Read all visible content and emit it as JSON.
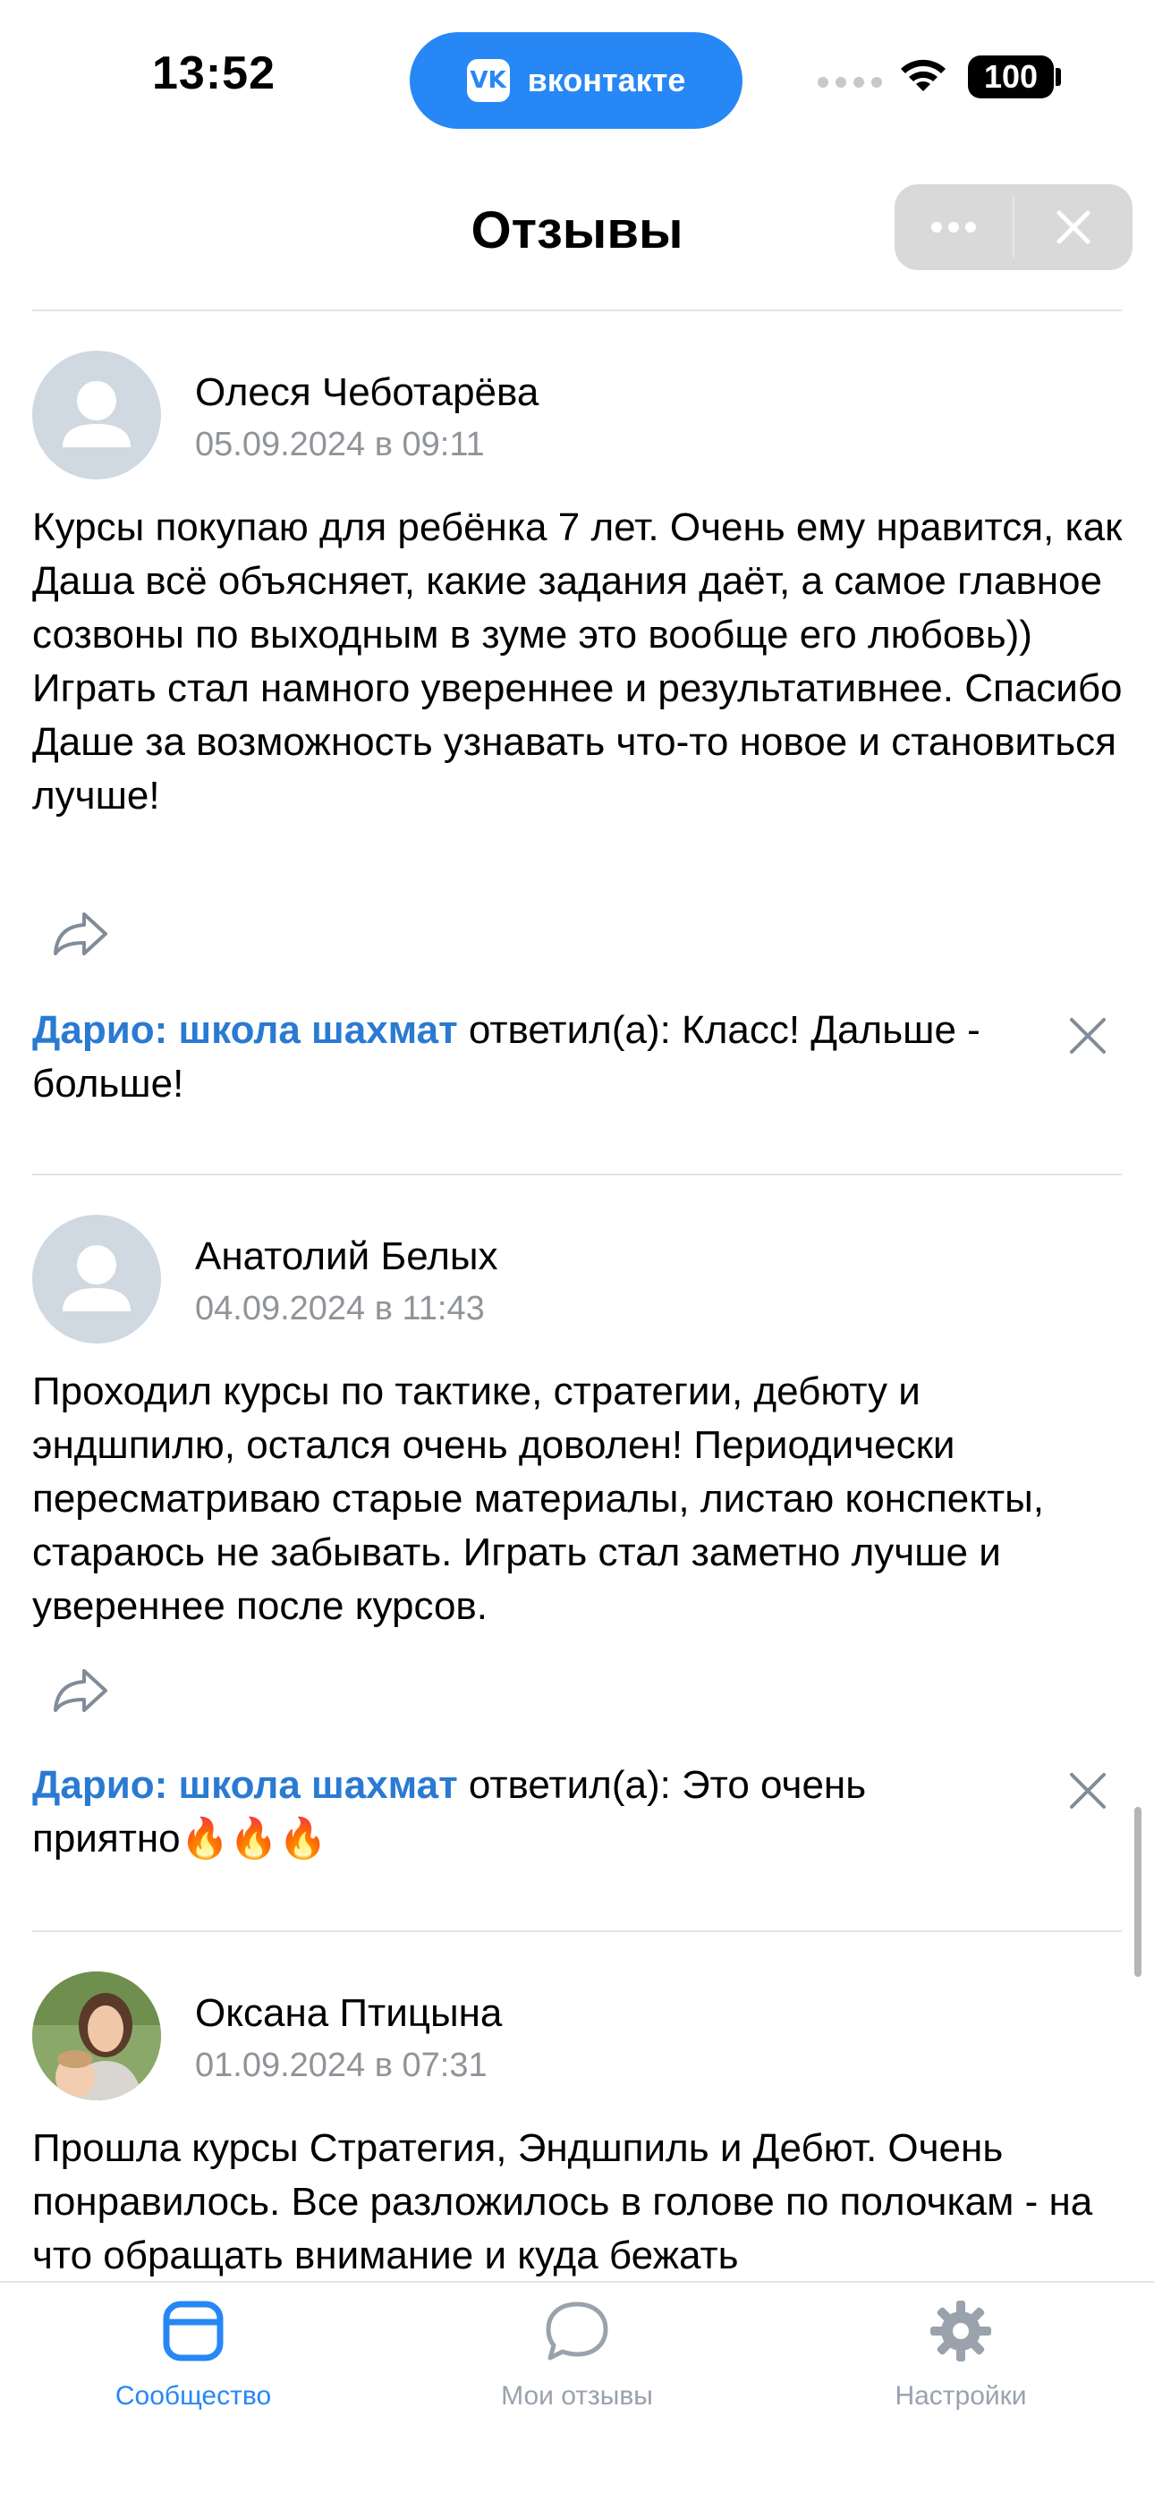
{
  "status_bar": {
    "time": "13:52",
    "app_badge": "вконтакте",
    "battery": "100"
  },
  "header": {
    "title": "Отзывы"
  },
  "reviews": [
    {
      "author": "Олеся Чеботарёва",
      "date": "05.09.2024 в 09:11",
      "text": "Курсы покупаю для ребёнка 7 лет. Очень ему нравится, как Даша всё объясняет, какие задания даёт, а самое главное созвоны по выходным в зуме это вообще его любовь)) Играть стал намного увереннее и результативнее. Спасибо Даше за возможность узнавать что-то новое и становиться лучше!",
      "reply_author": "Дарио: школа шахмат",
      "reply_text": " ответил(а): Класс! Дальше - больше!"
    },
    {
      "author": "Анатолий Белых",
      "date": "04.09.2024 в 11:43",
      "text": "Проходил курсы по тактике, стратегии, дебюту и эндшпилю, остался очень доволен! Периодически пересматриваю старые материалы, листаю конспекты, стараюсь не забывать. Играть стал заметно лучше и увереннее после курсов.",
      "reply_author": "Дарио: школа шахмат",
      "reply_text": " ответил(а): Это очень приятно🔥🔥🔥"
    },
    {
      "author": "Оксана Птицына",
      "date": "01.09.2024 в 07:31",
      "text": "Прошла курсы Стратегия, Эндшпиль и Дебют. Очень понравилось. Все разложилось в голове по полочкам - на что обращать внимание и куда бежать"
    }
  ],
  "tabs": [
    {
      "label": "Сообщество",
      "icon": "community-icon",
      "active": true
    },
    {
      "label": "Мои отзывы",
      "icon": "chat-bubble-icon",
      "active": false
    },
    {
      "label": "Настройки",
      "icon": "gear-icon",
      "active": false
    }
  ],
  "colors": {
    "accent": "#2787f5",
    "reply_author": "#2a7ad2",
    "secondary_text": "#909499"
  }
}
